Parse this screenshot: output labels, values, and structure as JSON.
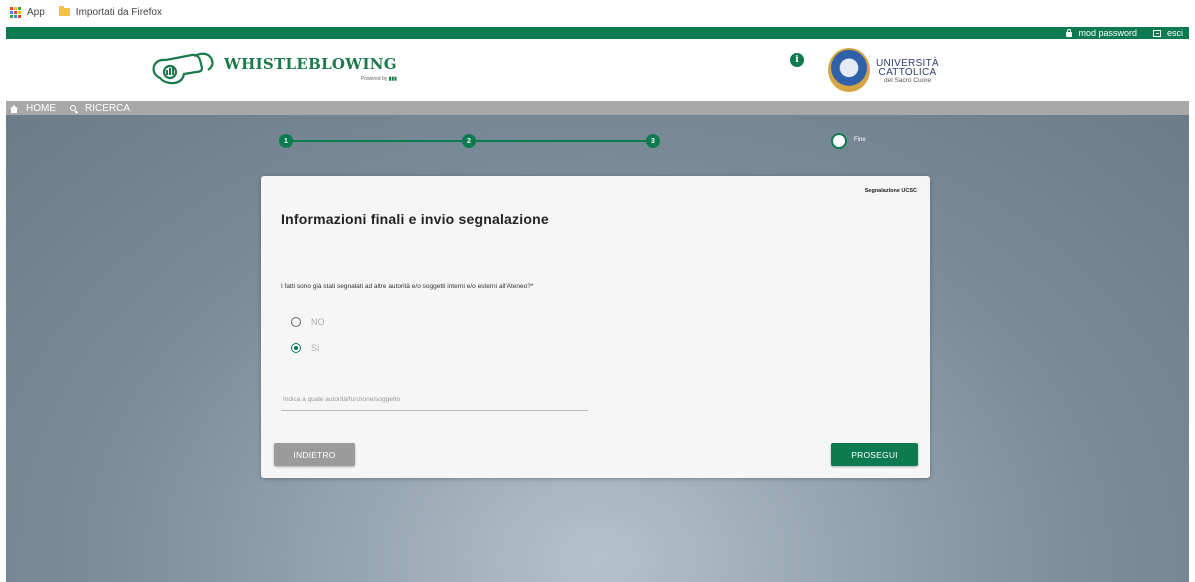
{
  "bookmarks": {
    "apps_label": "App",
    "folder_label": "Importati da Firefox"
  },
  "topbar": {
    "change_password": "mod password",
    "logout": "esci"
  },
  "header": {
    "logo_title": "WHISTLEBLOWING",
    "logo_powered": "Powered by",
    "info_symbol": "i",
    "uni_line1": "UNIVERSITÀ",
    "uni_line2": "CATTOLICA",
    "uni_line3": "del Sacro Cuore"
  },
  "nav": {
    "home": "HOME",
    "search": "RICERCA"
  },
  "stepper": {
    "steps": [
      "1",
      "2",
      "3"
    ],
    "final_label": "Fine"
  },
  "card": {
    "tag": "Segnalazione UCSC",
    "title": "Informazioni finali e invio segnalazione",
    "question": "I fatti sono già stati segnalati ad altre autorità e/o soggetti interni e/o esterni all'Ateneo?*",
    "options": [
      {
        "label": "NO",
        "selected": false
      },
      {
        "label": "SI",
        "selected": true
      }
    ],
    "input_placeholder": "Indica a quale autorità/funzione/soggetto",
    "input_value": "",
    "back_button": "INDIETRO",
    "next_button": "PROSEGUI"
  },
  "colors": {
    "brand_green": "#0d7a50",
    "nav_grey": "#a8a8a8",
    "back_button_grey": "#9b9b9b"
  }
}
